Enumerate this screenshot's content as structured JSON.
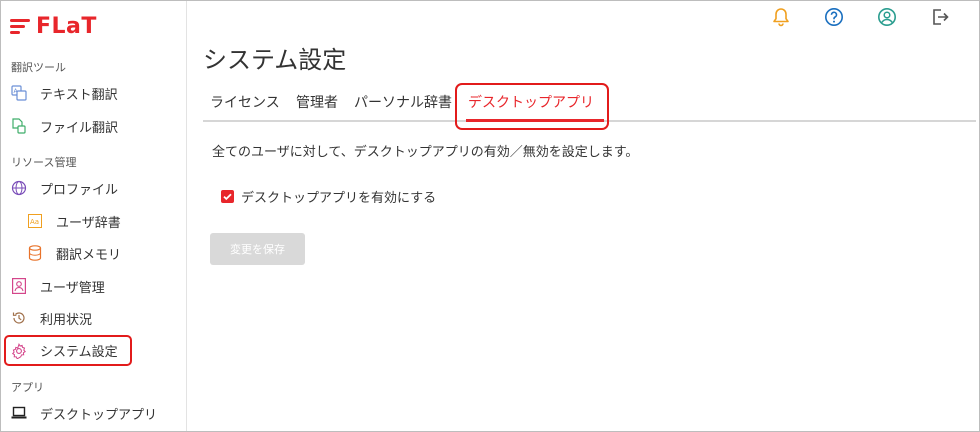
{
  "brand": {
    "name": "FLaT",
    "color": "#e8262b"
  },
  "sidebar": {
    "sections": [
      {
        "label": "翻訳ツール"
      },
      {
        "label": "リソース管理"
      },
      {
        "label": "アプリ"
      }
    ],
    "items": [
      {
        "label": "テキスト翻訳",
        "icon": "text-translate-icon"
      },
      {
        "label": "ファイル翻訳",
        "icon": "file-translate-icon"
      },
      {
        "label": "プロファイル",
        "icon": "globe-icon"
      },
      {
        "label": "ユーザ辞書",
        "icon": "dictionary-icon"
      },
      {
        "label": "翻訳メモリ",
        "icon": "database-icon"
      },
      {
        "label": "ユーザ管理",
        "icon": "user-card-icon"
      },
      {
        "label": "利用状況",
        "icon": "history-icon"
      },
      {
        "label": "システム設定",
        "icon": "gear-icon",
        "active": true
      },
      {
        "label": "デスクトップアプリ",
        "icon": "laptop-icon"
      }
    ]
  },
  "topbar": {
    "icons": [
      "bell-icon",
      "help-icon",
      "account-icon",
      "logout-icon"
    ],
    "colors": {
      "bell": "#f0a020",
      "help": "#1a6fbf",
      "account": "#2a9d8f",
      "logout": "#555555"
    }
  },
  "main": {
    "title": "システム設定",
    "tabs": [
      {
        "label": "ライセンス"
      },
      {
        "label": "管理者"
      },
      {
        "label": "パーソナル辞書"
      },
      {
        "label": "デスクトップアプリ",
        "active": true
      }
    ],
    "description": "全てのユーザに対して、デスクトップアプリの有効／無効を設定します。",
    "checkbox_label": "デスクトップアプリを有効にする",
    "checkbox_checked": true,
    "save_label": "変更を保存",
    "save_disabled": true
  },
  "colors": {
    "accent": "#e8262b",
    "highlight_border": "#e21b1b",
    "disabled_button": "#d9d9d9"
  }
}
